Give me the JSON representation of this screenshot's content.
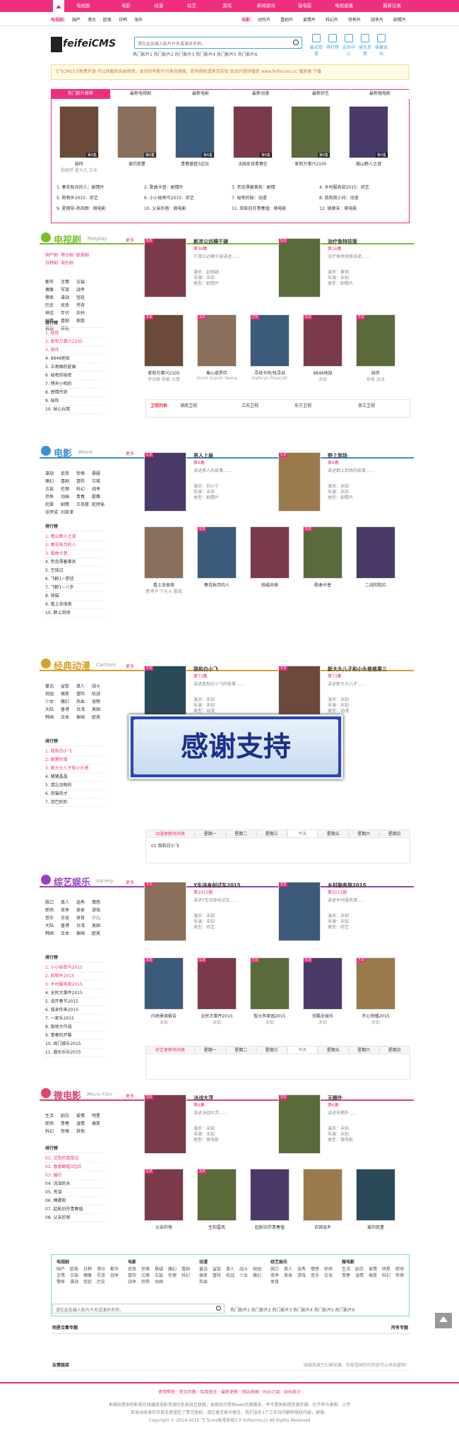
{
  "nav": {
    "items": [
      "电视剧",
      "电影",
      "动漫",
      "综艺",
      "游戏",
      "新闻资讯",
      "微电影",
      "电视直播",
      "最新记录"
    ]
  },
  "subnav": {
    "left_label": "电视剧：",
    "left": [
      "国产",
      "港台",
      "欧美",
      "日韩",
      "海外"
    ],
    "right_label": "电影：",
    "right": [
      "动作片",
      "喜剧片",
      "爱情片",
      "科幻片",
      "恐怖片",
      "战争片",
      "剧情片"
    ]
  },
  "logo": {
    "text": "feifeiCMS"
  },
  "search": {
    "placeholder": "请在此处输入影片片名或演员名称。",
    "hot": "热门影片1 热门影片2 热门影片3 热门影片4 热门影片5 热门影片6"
  },
  "toolbar": [
    "最近观看",
    "排行榜",
    "会员中心",
    "留言反馈",
    "收藏本站"
  ],
  "notice": "飞飞CMS3.0免费开源 可以转载和自由使用，本站所有影片均来自网络，若有侵权请来信告知 本站只提供播放 www.feifeicms.cc 播放器 下载",
  "hot_tabs": [
    "热门影片推荐",
    "最新电视剧",
    "最新电影",
    "最新动漫",
    "最新综艺",
    "最新微电影"
  ],
  "hot": {
    "posters": [
      {
        "cap": "秘阵",
        "sub": "杨丽萍 霍大凡 王冰",
        "ep": "第6集"
      },
      {
        "cap": "爱的我董",
        "sub": "",
        "ep": "第6集"
      },
      {
        "cap": "青春盛筵3边沿",
        "sub": "",
        "ep": "第6集"
      },
      {
        "cap": "法国女孩青春在",
        "sub": "",
        "ep": "第6集"
      },
      {
        "cap": "家和万事兴2105",
        "sub": "",
        "ep": "第6集"
      },
      {
        "cap": "嵩山野人之谜",
        "sub": "",
        "ep": "第6集"
      }
    ],
    "links": [
      "1. 春花秋月的人：剧情片",
      "2. 歌曲卡普：剧情片",
      "3. 荒岛漂着事务：剧情",
      "4. 乡村服务旅2015：综艺",
      "5. 购物乡2015：综艺",
      "6. 小小秘密鸟2015：综艺",
      "7. 秘密的秘：动漫",
      "8. 我和我小问：动漫",
      "9. 星期导-热风图：微电影",
      "10. 父亲的爸：微电影",
      "11. 亚影旧芬青春值：微电影",
      "12. 微傻末：微电影"
    ]
  },
  "tv": {
    "title": "电视剧",
    "en": "Teleplay",
    "more": "更多",
    "tags_pink": [
      "国产剧",
      "港台剧",
      "欧美剧",
      "日韩剧",
      "海外剧"
    ],
    "tags": [
      "都市",
      "言情",
      "古装",
      "偶像",
      "军旅",
      "战争",
      "警匪",
      "谍战",
      "宫廷",
      "历史",
      "武侠",
      "传奇",
      "神话",
      "年代",
      "农村",
      "剧情",
      "喜剧",
      "家庭",
      "抗战",
      "其他"
    ],
    "rank_title": "排行榜",
    "rank": [
      "1. 秘阵",
      "2. 家和万事兴2105",
      "3. 陪伴",
      "4. 8848地狱",
      "5. 五角厢的延展",
      "6. 秘密的秘密",
      "7. 傅天小明的",
      "8. 感情传奇",
      "9. 秘阵",
      "10. 秘心似笑"
    ],
    "feat": [
      {
        "tt": "新凉公远横千骑",
        "ep": "第36集",
        "ds": "千骑公远横千骑讲述……",
        "cast": "演员：赵丽颖",
        "dir": "导演：未知",
        "type": "类型：剧情片"
      },
      {
        "tt": "治疗鱼特技版",
        "ep": "第16集",
        "ds": "治疗鱼特技版讲述……",
        "cast": "演员：黄渤",
        "dir": "导演：未知",
        "type": "类型：剧情片"
      }
    ],
    "posters": [
      {
        "cap": "家和万事兴2105",
        "sub": "李诗卿 杨紫 王倩",
        "sc": "3.0"
      },
      {
        "cap": "晕心欲罗匹",
        "sub": "Gumi Suzuki Yeena",
        "sc": "3.0"
      },
      {
        "cap": "寻找卡特/找寻自",
        "sub": "Kathryn Prescott",
        "sc": "7.0"
      },
      {
        "cap": "8848地狱",
        "sub": "未知",
        "sc": "5.0"
      },
      {
        "cap": "陪伴",
        "sub": "徐帆 张泽",
        "sc": "7.0"
      }
    ],
    "tv": [
      "卫视列表",
      "湖南卫视",
      "江苏卫视",
      "东方卫视",
      "浙江卫视"
    ]
  },
  "movie": {
    "title": "电影",
    "en": "Movie",
    "more": "更多",
    "tags": [
      "谍战",
      "武侠",
      "惊悚",
      "悬疑",
      "魔幻",
      "喜剧",
      "冒险",
      "灾难",
      "古装",
      "伦理",
      "科幻",
      "战争",
      "恐怖",
      "动画",
      "青春",
      "歌舞",
      "犯罪",
      "剧情",
      "王苑楼",
      "蛇特偷",
      "张尹成",
      "刘亚津"
    ],
    "rank_title": "排行榜",
    "rank": [
      "1. 基山野人之谜",
      "2. 春花秋月的人",
      "3. 歌曲卡普",
      "4. 荒岛漂着事务",
      "5. 空城记",
      "6. 飞醉1~星徒",
      "7. 飞醉1~八岁",
      "8. 核磁",
      "9. 看上去很美",
      "10. 野上到场"
    ],
    "feat": [
      {
        "tt": "男人上局",
        "ep": "第6集",
        "ds": "讲述男人的故事……",
        "cast": "演员：刘小宁",
        "dir": "导演：未知",
        "type": "类型：剧情片"
      },
      {
        "tt": "野上到场",
        "ep": "第6集",
        "ds": "讲述野上到场的故事……",
        "cast": "演员：未知",
        "dir": "导演：未知",
        "type": "类型：剧情片"
      }
    ],
    "posters": [
      {
        "cap": "看上去很美",
        "sub": "董博予 宁元元 戴威",
        "sc": ""
      },
      {
        "cap": "春花秋月的人",
        "sub": "",
        "sc": "1.0"
      },
      {
        "cap": "核磁共振",
        "sub": "",
        "sc": ""
      },
      {
        "cap": "歌曲卡普",
        "sub": "",
        "sc": "5.0"
      },
      {
        "cap": "二战的阻拦",
        "sub": "",
        "sc": ""
      }
    ]
  },
  "anime": {
    "title": "经典动漫",
    "en": "Cartoon",
    "more": "更多",
    "tags": [
      "童话",
      "益智",
      "真人",
      "战斗",
      "校园",
      "搞笑",
      "冒险",
      "机战",
      "少女",
      "魔幻",
      "热血",
      "宠物",
      "大陆",
      "香港",
      "台湾",
      "美国",
      "韩国",
      "日本",
      "泰国",
      "欧美"
    ],
    "rank_title": "排行榜",
    "rank": [
      "1. 我和白小飞",
      "2. 貌猩的猎",
      "3. 新大头儿子和小头爸",
      "4. 猪猪晶晶",
      "5. 遗忘动物的",
      "6. 奇猫奇才",
      "7. 泥巴奶奶"
    ],
    "feat": [
      {
        "tt": "我和白小飞",
        "ep": "第73集",
        "ds": "讲述我和白小飞的故事……",
        "cast": "演员：未知",
        "dir": "导演：未知",
        "type": "类型：动漫"
      },
      {
        "tt": "新大头儿子和小头爸爸第三",
        "ep": "第73集",
        "ds": "讲述新大头儿子……",
        "cast": "演员：未知",
        "dir": "导演：未知",
        "type": "类型：动漫"
      }
    ],
    "thanks": "感谢支持",
    "week": [
      "动漫更新时间表",
      "星期一",
      "星期二",
      "星期三",
      "今天",
      "星期五",
      "星期六",
      "星期日"
    ],
    "week_item": "我和白小飞"
  },
  "variety": {
    "title": "综艺娱乐",
    "en": "Variety",
    "more": "更多",
    "tags": [
      "脱口",
      "真人",
      "选秀",
      "情感",
      "职场",
      "竞争",
      "美食",
      "游戏",
      "音乐",
      "访谈",
      "体育",
      "少儿",
      "大陆",
      "香港",
      "台湾",
      "美国",
      "韩国",
      "日本",
      "泰国",
      "欧美"
    ],
    "rank_title": "排行榜",
    "rank": [
      "1. 小小秘密鸟2015",
      "2. 购物乡2015",
      "3. 乡村服务旅2015",
      "4. 全民大事件2015",
      "5. 谈开春节2015",
      "6. 摇来你来2015",
      "7. 一家乐2015",
      "8. 极地大作战",
      "9. 青春的开幕",
      "10. 周门娱乐2015",
      "11. 盛乐乐乐2015"
    ],
    "feat": [
      {
        "tt": "Y车诗身创试车2015",
        "ep": "第2015期",
        "ds": "讲述Y车诗身创试车……",
        "cast": "演员：未知",
        "dir": "导演：未知",
        "type": "类型：综艺"
      },
      {
        "tt": "乡村服务旅2015",
        "ep": "第2015期",
        "ds": "讲述乡村服务旅……",
        "cast": "演员：未知",
        "dir": "导演：未知",
        "type": "类型：综艺"
      }
    ],
    "posters": [
      {
        "cap": "内地景周报告",
        "sub": "未知",
        "sc": "3.0"
      },
      {
        "cap": "全民大事件2015",
        "sub": "未知",
        "sc": "1.0"
      },
      {
        "cap": "智元有家园2015",
        "sub": "未知",
        "sc": "7.0"
      },
      {
        "cap": "优酷全娱乐",
        "sub": "未知",
        "sc": "5.0"
      },
      {
        "cap": "开心快播2015",
        "sub": "未知",
        "sc": "7.0"
      }
    ],
    "week": [
      "综艺更新时间表",
      "星期一",
      "星期二",
      "星期三",
      "今天",
      "星期五",
      "星期六",
      "星期日"
    ]
  },
  "micro": {
    "title": "微电影",
    "en": "Micro Film",
    "more": "更多",
    "tags": [
      "生活",
      "励志",
      "爱情",
      "明星",
      "职场",
      "青春",
      "温情",
      "搞笑",
      "科幻",
      "惊悚",
      "其他"
    ],
    "rank_title": "排行榜",
    "rank": [
      "01. 沈阳的盘菜边",
      "02. 香香翻越3边沿",
      "03. 婚约",
      "04. 流泪的水",
      "05. 亮泪",
      "06. 绳骤阳",
      "07. 起影旧芬青春值",
      "08. 父亲的爸"
    ],
    "feat": [
      {
        "tt": "决战大浮",
        "ep": "第6集",
        "ds": "讲述决战大浮……",
        "cast": "演员：未知",
        "dir": "导演：未知",
        "type": "类型：微电影"
      },
      {
        "tt": "天赐外",
        "ep": "第6集",
        "ds": "讲述天赐外……",
        "cast": "演员：未知",
        "dir": "导演：未知",
        "type": "类型：微电影"
      }
    ],
    "posters": [
      {
        "cap": "父亲的爸",
        "sub": "",
        "sc": "1.0"
      },
      {
        "cap": "生和雷风",
        "sub": "",
        "sc": "3.0"
      },
      {
        "cap": "起影旧芬青春值",
        "sub": "",
        "sc": ""
      },
      {
        "cap": "衣锦谈乡",
        "sub": "",
        "sc": ""
      },
      {
        "cap": "爱的我董",
        "sub": "",
        "sc": ""
      }
    ]
  },
  "directory": {
    "cols": [
      {
        "h": "电视剧",
        "items": "国产 欧美 日韩 港台 都市 言情 古装 偶像 军旅 战争 警匪 谍战 宫廷 历史"
      },
      {
        "h": "电影",
        "items": "武侠 惊悚 悬疑 魔幻 喜剧 冒险 灾难 古装 伦理 科幻 战争 恐怖 动画"
      },
      {
        "h": "动漫",
        "items": "童话 益智 真人 战斗 校园 搞笑 冒险 机战 少女 魔幻 热血"
      },
      {
        "h": "综艺娱乐",
        "items": "脱口 真人 选秀 情感 职场 竞争 美食 游戏 音乐 访谈 体育"
      },
      {
        "h": "微电影",
        "items": "生活 励志 爱情 明星 职场 青春 温情 搞笑 科幻 惊悚"
      }
    ]
  },
  "bottom": {
    "placeholder": "请在此处输入影片片名或演员名称。",
    "hot": "热门影片1 热门影片2 热门影片3 热门影片4 热门影片5 热门影片6",
    "special": "明星合集专题",
    "all": "所有专题",
    "links": "友情链接",
    "links_note": "国旗背景空幻景安康，你爱祖国你的你就可以来加盟哦！",
    "footer_links": "使用帮助 · 常见问题 · 给我留言 · 最新更新 · 网站地图 · RSS订阅 · 站长统计",
    "copyright1": "本网站提供的影视在线播放电影资源均系来自互联网，本网站只提供web页面服务，并不提供影视资源存储，也不参与录制、上传",
    "copyright2": "若本站收录的节目无意侵犯了贵司版权，请在留言板中留言，我们会在1个工作日内删除侵权内容，谢谢。",
    "copyright3": "Copyright © 2014-2015 飞飞cms影视系统3.0 feifeicms.cc All Rights Reserved"
  }
}
